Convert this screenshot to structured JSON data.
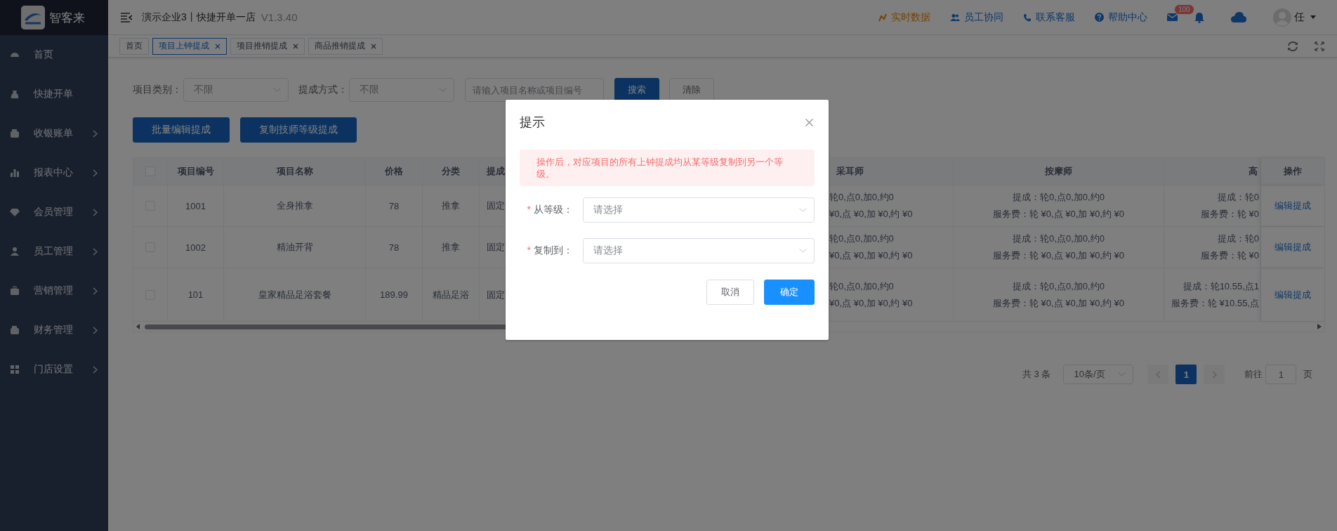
{
  "app": {
    "logo_text": "智客来"
  },
  "header": {
    "title": "演示企业3丨快捷开单一店",
    "version": "V1.3.40",
    "links": [
      {
        "label": "实时数据",
        "kind": "data"
      },
      {
        "label": "员工协同",
        "kind": "team"
      },
      {
        "label": "联系客服",
        "kind": "phone"
      },
      {
        "label": "帮助中心",
        "kind": "help"
      }
    ],
    "mail_badge": "100",
    "user": "任"
  },
  "sidebar": {
    "items": [
      {
        "label": "首页",
        "arrow": false
      },
      {
        "label": "快捷开单",
        "arrow": false
      },
      {
        "label": "收银账单",
        "arrow": true
      },
      {
        "label": "报表中心",
        "arrow": true
      },
      {
        "label": "会员管理",
        "arrow": true
      },
      {
        "label": "员工管理",
        "arrow": true
      },
      {
        "label": "营销管理",
        "arrow": true
      },
      {
        "label": "财务管理",
        "arrow": true
      },
      {
        "label": "门店设置",
        "arrow": true
      }
    ]
  },
  "tabs": [
    {
      "label": "首页",
      "closable": false,
      "selected": false
    },
    {
      "label": "项目上钟提成",
      "closable": true,
      "selected": true
    },
    {
      "label": "项目推销提成",
      "closable": true,
      "selected": false
    },
    {
      "label": "商品推销提成",
      "closable": true,
      "selected": false
    }
  ],
  "filters": {
    "category_label": "项目类别：",
    "category_placeholder": "不限",
    "method_label": "提成方式：",
    "method_placeholder": "不限",
    "search_placeholder": "请输入项目名称或项目编号",
    "search_button": "搜索",
    "clear_button": "清除"
  },
  "actions": [
    "批量编辑提成",
    "复制技师等级提成"
  ],
  "table": {
    "select_all": false,
    "columns": [
      "项目编号",
      "项目名称",
      "价格",
      "分类",
      "提成",
      "采耳师",
      "按摩师",
      "高",
      "操作"
    ],
    "rows": [
      {
        "checked": false,
        "code": "1001",
        "name": "全身推拿",
        "price": "78",
        "category": "推拿",
        "method": "固定",
        "column_6": [
          "轮0,点0,加0,约0",
          "¥0,点 ¥0,加 ¥0,约 ¥0"
        ],
        "column_7": [
          "提成：轮0,点0,加0,约0",
          "服务费：轮 ¥0,点 ¥0,加 ¥0,约 ¥0"
        ],
        "column_8": [
          "提成：轮0",
          "服务费：轮 ¥0"
        ],
        "action": "编辑提成"
      },
      {
        "checked": false,
        "code": "1002",
        "name": "精油开背",
        "price": "78",
        "category": "推拿",
        "method": "固定",
        "column_6": [
          "轮0,点0,加0,约0",
          "¥0,点 ¥0,加 ¥0,约 ¥0"
        ],
        "column_7": [
          "提成：轮0,点0,加0,约0",
          "服务费：轮 ¥0,点 ¥0,加 ¥0,约 ¥0"
        ],
        "column_8": [
          "提成：轮0",
          "服务费：轮 ¥0"
        ],
        "action": "编辑提成"
      },
      {
        "checked": false,
        "code": "101",
        "name": "皇家精品足浴套餐",
        "price": "189.99",
        "category": "精品足浴",
        "method": "固定",
        "column_6": [
          "轮0,点0,加0,约0",
          "¥0,点 ¥0,加 ¥0,约 ¥0"
        ],
        "column_7": [
          "提成：轮0,点0,加0,约0",
          "服务费：轮 ¥0,点 ¥0,加 ¥0,约 ¥0"
        ],
        "column_8": [
          "提成：轮10.55,点1",
          "服务费：轮 ¥10.55,点"
        ],
        "action": "编辑提成"
      }
    ]
  },
  "pagination": {
    "total": "共 3 条",
    "page_size": "10条/页",
    "pages": [
      {
        "label": "1",
        "selected": true
      }
    ],
    "goto_label": "前往",
    "goto_value": "1",
    "page_suffix": "页"
  },
  "dialog": {
    "title": "提示",
    "warning": "操作后，对应项目的所有上钟提成均从某等级复制到另一个等级。",
    "fields": [
      {
        "required_mark": "*",
        "label": "从等级：",
        "placeholder": "请选择"
      },
      {
        "required_mark": "*",
        "label": "复制到：",
        "placeholder": "请选择"
      }
    ],
    "cancel": "取消",
    "confirm": "确定"
  }
}
